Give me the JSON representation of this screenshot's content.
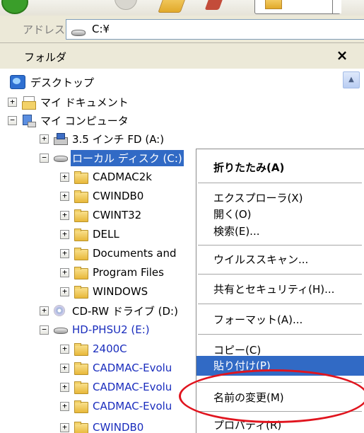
{
  "address": {
    "label": "アドレス(D)",
    "value": "C:¥"
  },
  "pane": {
    "title": "フォルダ",
    "close": "×"
  },
  "tree": [
    {
      "label": "デスクトップ",
      "pm": "",
      "icon": "desktop-icon",
      "state": ""
    },
    {
      "label": "マイ ドキュメント",
      "pm": "+",
      "icon": "my-documents-icon",
      "state": ""
    },
    {
      "label": "マイ コンピュータ",
      "pm": "−",
      "icon": "my-computer-icon",
      "state": ""
    },
    {
      "label": "3.5 インチ FD (A:)",
      "pm": "+",
      "icon": "floppy-drive-icon",
      "state": ""
    },
    {
      "label": "ローカル ディスク (C:)",
      "pm": "−",
      "icon": "hard-disk-icon",
      "state": "selected"
    },
    {
      "label": "CADMAC2k",
      "pm": "+",
      "icon": "folder-icon",
      "state": ""
    },
    {
      "label": "CWINDB0",
      "pm": "+",
      "icon": "folder-icon",
      "state": ""
    },
    {
      "label": "CWINT32",
      "pm": "+",
      "icon": "folder-icon",
      "state": ""
    },
    {
      "label": "DELL",
      "pm": "+",
      "icon": "folder-icon",
      "state": ""
    },
    {
      "label": "Documents and",
      "pm": "+",
      "icon": "folder-icon",
      "state": ""
    },
    {
      "label": "Program Files",
      "pm": "+",
      "icon": "folder-icon",
      "state": ""
    },
    {
      "label": "WINDOWS",
      "pm": "+",
      "icon": "folder-icon",
      "state": ""
    },
    {
      "label": "CD-RW ドライブ (D:)",
      "pm": "+",
      "icon": "cd-drive-icon",
      "state": ""
    },
    {
      "label": "HD-PHSU2 (E:)",
      "pm": "−",
      "icon": "hard-disk-icon",
      "state": "link"
    },
    {
      "label": "2400C",
      "pm": "+",
      "icon": "folder-icon",
      "state": "link"
    },
    {
      "label": "CADMAC-Evolu",
      "pm": "+",
      "icon": "folder-icon",
      "state": "link"
    },
    {
      "label": "CADMAC-Evolu",
      "pm": "+",
      "icon": "folder-icon",
      "state": "link"
    },
    {
      "label": "CADMAC-Evolu",
      "pm": "+",
      "icon": "folder-icon",
      "state": "link"
    },
    {
      "label": "CWINDB0",
      "pm": "+",
      "icon": "folder-icon",
      "state": "link"
    }
  ],
  "menu": {
    "collapse": "折りたたみ(A)",
    "explorer": "エクスプローラ(X)",
    "open": "開く(O)",
    "search": "検索(E)...",
    "virus_scan": "ウイルススキャン...",
    "sharing": "共有とセキュリティ(H)...",
    "format": "フォーマット(A)...",
    "copy": "コピー(C)",
    "paste": "貼り付け(P)",
    "rename": "名前の変更(M)",
    "properties": "プロパティ(R)"
  },
  "colors": {
    "selection": "#316ac5",
    "annotation": "#e0141e",
    "link": "#1a2dbd"
  }
}
